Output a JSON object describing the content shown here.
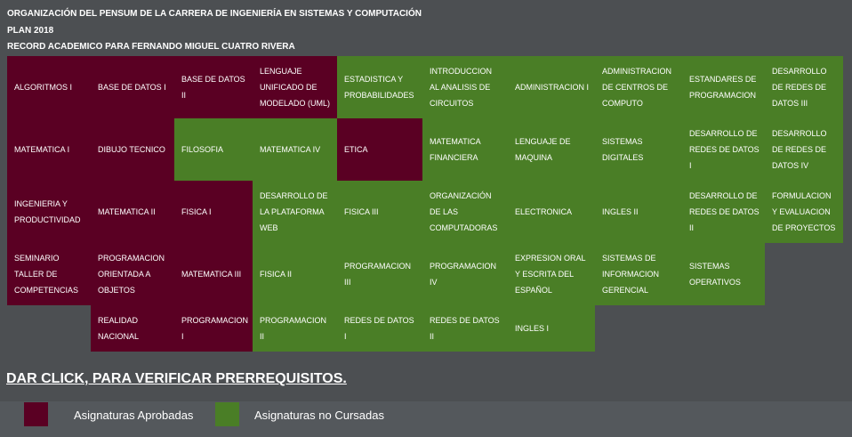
{
  "header": {
    "line1": "ORGANIZACIÓN DEL PENSUM DE LA CARRERA DE INGENIERÍA EN SISTEMAS Y COMPUTACIÓN",
    "line2": "PLAN 2018",
    "line3": "RECORD ACADEMICO PARA FERNANDO MIGUEL CUATRO RIVERA"
  },
  "colors": {
    "approved": "#5a0023",
    "not_taken": "#4a7e26",
    "background": "#4c4f52"
  },
  "courses": [
    {
      "name": "ALGORITMOS I",
      "status": "approved",
      "col": 0,
      "row": 0
    },
    {
      "name": "BASE DE DATOS I",
      "status": "approved",
      "col": 1,
      "row": 0
    },
    {
      "name": "BASE DE DATOS II",
      "status": "approved",
      "col": 2,
      "row": 0
    },
    {
      "name": "LENGUAJE UNIFICADO DE MODELADO (UML)",
      "status": "approved",
      "col": 3,
      "row": 0
    },
    {
      "name": "ESTADISTICA Y PROBABILIDADES",
      "status": "not_taken",
      "col": 4,
      "row": 0
    },
    {
      "name": "INTRODUCCION AL ANALISIS DE CIRCUITOS",
      "status": "not_taken",
      "col": 5,
      "row": 0
    },
    {
      "name": "ADMINISTRACION I",
      "status": "not_taken",
      "col": 6,
      "row": 0
    },
    {
      "name": "ADMINISTRACION DE CENTROS DE COMPUTO",
      "status": "not_taken",
      "col": 7,
      "row": 0
    },
    {
      "name": "ESTANDARES DE PROGRAMACION",
      "status": "not_taken",
      "col": 8,
      "row": 0
    },
    {
      "name": "DESARROLLO DE REDES DE DATOS III",
      "status": "not_taken",
      "col": 9,
      "row": 0
    },
    {
      "name": "MATEMATICA I",
      "status": "approved",
      "col": 0,
      "row": 1
    },
    {
      "name": "DIBUJO TECNICO",
      "status": "approved",
      "col": 1,
      "row": 1
    },
    {
      "name": "FILOSOFIA",
      "status": "not_taken",
      "col": 2,
      "row": 1
    },
    {
      "name": "MATEMATICA IV",
      "status": "not_taken",
      "col": 3,
      "row": 1
    },
    {
      "name": "ETICA",
      "status": "approved",
      "col": 4,
      "row": 1
    },
    {
      "name": "MATEMATICA FINANCIERA",
      "status": "not_taken",
      "col": 5,
      "row": 1
    },
    {
      "name": "LENGUAJE DE MAQUINA",
      "status": "not_taken",
      "col": 6,
      "row": 1
    },
    {
      "name": "SISTEMAS DIGITALES",
      "status": "not_taken",
      "col": 7,
      "row": 1
    },
    {
      "name": "DESARROLLO DE REDES DE DATOS I",
      "status": "not_taken",
      "col": 8,
      "row": 1
    },
    {
      "name": "DESARROLLO DE REDES DE DATOS IV",
      "status": "not_taken",
      "col": 9,
      "row": 1
    },
    {
      "name": "INGENIERIA Y PRODUCTIVIDAD",
      "status": "approved",
      "col": 0,
      "row": 2
    },
    {
      "name": "MATEMATICA II",
      "status": "approved",
      "col": 1,
      "row": 2
    },
    {
      "name": "FISICA I",
      "status": "approved",
      "col": 2,
      "row": 2
    },
    {
      "name": "DESARROLLO DE LA PLATAFORMA WEB",
      "status": "not_taken",
      "col": 3,
      "row": 2
    },
    {
      "name": "FISICA III",
      "status": "not_taken",
      "col": 4,
      "row": 2
    },
    {
      "name": "ORGANIZACIÓN DE LAS COMPUTADORAS",
      "status": "not_taken",
      "col": 5,
      "row": 2
    },
    {
      "name": "ELECTRONICA",
      "status": "not_taken",
      "col": 6,
      "row": 2
    },
    {
      "name": "INGLES II",
      "status": "not_taken",
      "col": 7,
      "row": 2
    },
    {
      "name": "DESARROLLO DE REDES DE DATOS II",
      "status": "not_taken",
      "col": 8,
      "row": 2
    },
    {
      "name": "FORMULACION Y EVALUACION DE PROYECTOS",
      "status": "not_taken",
      "col": 9,
      "row": 2
    },
    {
      "name": "SEMINARIO TALLER DE COMPETENCIAS",
      "status": "approved",
      "col": 0,
      "row": 3
    },
    {
      "name": "PROGRAMACION ORIENTADA A OBJETOS",
      "status": "approved",
      "col": 1,
      "row": 3
    },
    {
      "name": "MATEMATICA III",
      "status": "approved",
      "col": 2,
      "row": 3
    },
    {
      "name": "FISICA II",
      "status": "not_taken",
      "col": 3,
      "row": 3
    },
    {
      "name": "PROGRAMACION III",
      "status": "not_taken",
      "col": 4,
      "row": 3
    },
    {
      "name": "PROGRAMACION IV",
      "status": "not_taken",
      "col": 5,
      "row": 3
    },
    {
      "name": "EXPRESION ORAL Y ESCRITA DEL ESPAÑOL",
      "status": "not_taken",
      "col": 6,
      "row": 3
    },
    {
      "name": "SISTEMAS DE INFORMACION GERENCIAL",
      "status": "not_taken",
      "col": 7,
      "row": 3
    },
    {
      "name": "SISTEMAS OPERATIVOS",
      "status": "not_taken",
      "col": 8,
      "row": 3
    },
    {
      "name": "REALIDAD NACIONAL",
      "status": "approved",
      "col": 1,
      "row": 4
    },
    {
      "name": "PROGRAMACION I",
      "status": "approved",
      "col": 2,
      "row": 4
    },
    {
      "name": "PROGRAMACION II",
      "status": "not_taken",
      "col": 3,
      "row": 4
    },
    {
      "name": "REDES DE DATOS I",
      "status": "not_taken",
      "col": 4,
      "row": 4
    },
    {
      "name": "REDES DE DATOS II",
      "status": "not_taken",
      "col": 5,
      "row": 4
    },
    {
      "name": "INGLES I",
      "status": "not_taken",
      "col": 6,
      "row": 4
    }
  ],
  "cta": "DAR CLICK, PARA VERIFICAR PRERREQUISITOS.",
  "legend": {
    "approved_label": "Asignaturas Aprobadas",
    "not_taken_label": "Asignaturas no Cursadas"
  }
}
